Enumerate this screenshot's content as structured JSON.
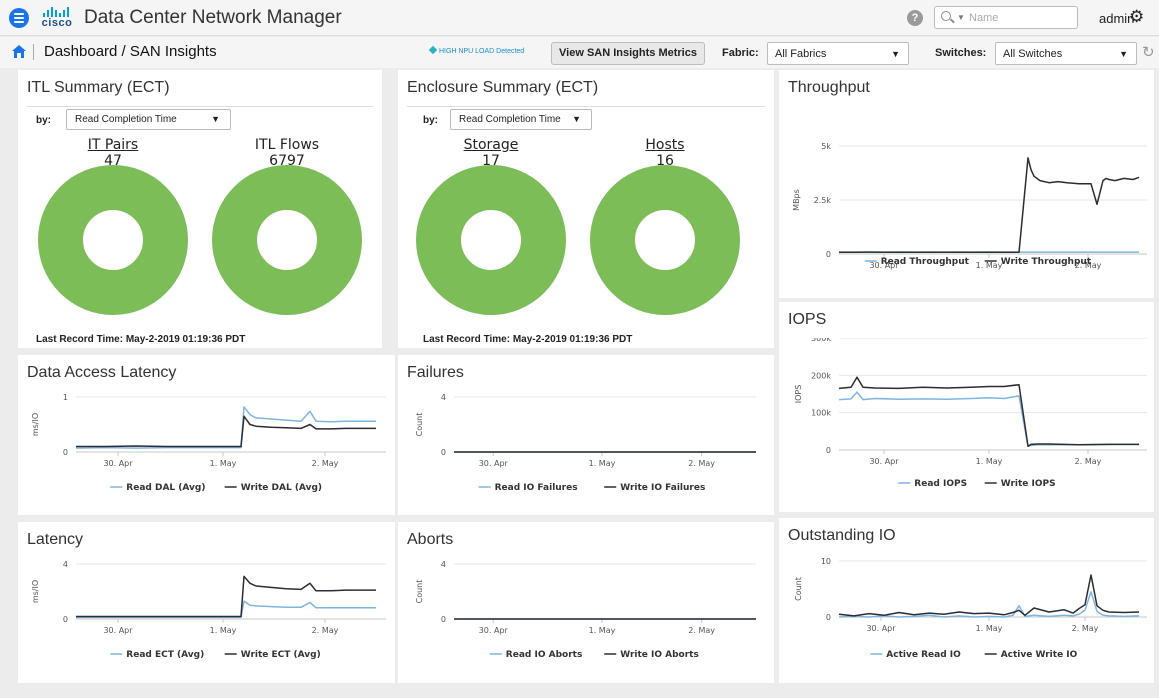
{
  "topbar": {
    "app_title": "Data Center Network Manager",
    "brand": "cisco",
    "search_placeholder": "Name",
    "user": "admin"
  },
  "subbar": {
    "breadcrumb": "Dashboard / SAN Insights",
    "alert": "HIGH NPU LOAD Detected",
    "view_metrics_button": "View SAN Insights Metrics",
    "fabric_label": "Fabric:",
    "fabric_value": "All Fabrics",
    "switches_label": "Switches:",
    "switches_value": "All Switches"
  },
  "itl_summary": {
    "title": "ITL Summary (ECT)",
    "by_label": "by:",
    "by_value": "Read Completion Time",
    "metric1_label": "IT Pairs",
    "metric1_value": "47",
    "metric2_label": "ITL Flows",
    "metric2_value": "6797",
    "last_record": "Last Record Time: May-2-2019 01:19:36 PDT",
    "donut_color": "#7cbd58"
  },
  "enclosure_summary": {
    "title": "Enclosure Summary (ECT)",
    "by_label": "by:",
    "by_value": "Read Completion Time",
    "metric1_label": "Storage",
    "metric1_value": "17",
    "metric2_label": "Hosts",
    "metric2_value": "16",
    "last_record": "Last Record Time: May-2-2019 01:19:36 PDT",
    "donut_color": "#7cbd58"
  },
  "panels": {
    "throughput": {
      "title": "Throughput"
    },
    "iops": {
      "title": "IOPS"
    },
    "dal": {
      "title": "Data Access Latency"
    },
    "failures": {
      "title": "Failures"
    },
    "outstanding": {
      "title": "Outstanding IO"
    },
    "latency": {
      "title": "Latency"
    },
    "aborts": {
      "title": "Aborts"
    }
  },
  "series_colors": {
    "read": "#7fb5e1",
    "write": "#2a2d33"
  },
  "chart_data": [
    {
      "type": "line",
      "id": "throughput",
      "title": "Throughput",
      "ylabel": "MBps",
      "ylim": [
        0,
        5000
      ],
      "yticks": [
        "0",
        "2.5k",
        "5k"
      ],
      "xticks": [
        "30. Apr",
        "1. May",
        "2. May"
      ],
      "x": [
        0,
        0.05,
        0.1,
        0.15,
        0.2,
        0.25,
        0.3,
        0.35,
        0.4,
        0.45,
        0.5,
        0.55,
        0.6,
        0.63,
        0.64,
        0.65,
        0.67,
        0.7,
        0.73,
        0.76,
        0.8,
        0.84,
        0.86,
        0.88,
        0.89,
        0.9,
        0.92,
        0.95,
        0.98,
        1.0
      ],
      "series": [
        {
          "name": "Read Throughput",
          "color": "#7fb5e1",
          "values": [
            90,
            90,
            92,
            90,
            91,
            90,
            92,
            90,
            91,
            90,
            92,
            90,
            90,
            90,
            90,
            90,
            90,
            90,
            90,
            90,
            90,
            90,
            90,
            90,
            90,
            90,
            90,
            90,
            90,
            90
          ]
        },
        {
          "name": "Write Throughput",
          "color": "#2a2d33",
          "values": [
            80,
            85,
            90,
            85,
            80,
            85,
            80,
            82,
            85,
            80,
            85,
            82,
            80,
            4450,
            3900,
            3600,
            3400,
            3300,
            3350,
            3300,
            3250,
            3250,
            2300,
            3400,
            3500,
            3450,
            3400,
            3500,
            3450,
            3550
          ]
        }
      ],
      "legend": "bottom"
    },
    {
      "type": "line",
      "id": "iops",
      "title": "IOPS",
      "ylabel": "IOPS",
      "ylim": [
        0,
        300000
      ],
      "yticks": [
        "0",
        "100k",
        "200k",
        "300k"
      ],
      "xticks": [
        "30. Apr",
        "1. May",
        "2. May"
      ],
      "x": [
        0,
        0.04,
        0.06,
        0.08,
        0.12,
        0.2,
        0.28,
        0.36,
        0.44,
        0.5,
        0.55,
        0.6,
        0.63,
        0.64,
        0.66,
        0.7,
        0.8,
        0.9,
        1.0
      ],
      "series": [
        {
          "name": "Read IOPS",
          "color": "#7fb5e1",
          "values": [
            135000,
            137000,
            155000,
            135000,
            138000,
            136000,
            137000,
            136000,
            138000,
            140000,
            138000,
            145000,
            10000,
            12000,
            14000,
            14000,
            14000,
            15000,
            15000
          ]
        },
        {
          "name": "Write IOPS",
          "color": "#2a2d33",
          "values": [
            165000,
            168000,
            195000,
            168000,
            166000,
            165000,
            168000,
            166000,
            168000,
            170000,
            170000,
            175000,
            10000,
            15000,
            16000,
            16000,
            14000,
            15000,
            15000
          ]
        }
      ],
      "legend": "bottom"
    },
    {
      "type": "line",
      "id": "dal",
      "title": "Data Access Latency",
      "ylabel": "ms/IO",
      "ylim": [
        0,
        1
      ],
      "yticks": [
        "0",
        "1"
      ],
      "xticks": [
        "30. Apr",
        "1. May",
        "2. May"
      ],
      "x": [
        0,
        0.1,
        0.2,
        0.3,
        0.4,
        0.5,
        0.55,
        0.56,
        0.58,
        0.6,
        0.65,
        0.7,
        0.75,
        0.78,
        0.8,
        0.85,
        0.9,
        1.0
      ],
      "series": [
        {
          "name": "Read DAL (Avg)",
          "color": "#7fb5e1",
          "values": [
            0.07,
            0.08,
            0.07,
            0.08,
            0.08,
            0.08,
            0.08,
            0.82,
            0.68,
            0.62,
            0.6,
            0.58,
            0.56,
            0.74,
            0.56,
            0.55,
            0.56,
            0.56
          ]
        },
        {
          "name": "Write DAL (Avg)",
          "color": "#2a2d33",
          "values": [
            0.1,
            0.1,
            0.11,
            0.1,
            0.1,
            0.1,
            0.1,
            0.65,
            0.5,
            0.47,
            0.45,
            0.44,
            0.43,
            0.5,
            0.42,
            0.42,
            0.43,
            0.43
          ]
        }
      ],
      "legend": "bottom"
    },
    {
      "type": "line",
      "id": "failures",
      "title": "Failures",
      "ylabel": "Count",
      "ylim": [
        0,
        4
      ],
      "yticks": [
        "0",
        "4"
      ],
      "xticks": [
        "30. Apr",
        "1. May",
        "2. May"
      ],
      "x": [
        0,
        1
      ],
      "series": [
        {
          "name": "Read IO Failures",
          "color": "#7fb5e1",
          "values": [
            0,
            0
          ]
        },
        {
          "name": "Write IO Failures",
          "color": "#2a2d33",
          "values": [
            0,
            0
          ]
        }
      ],
      "legend": "bottom"
    },
    {
      "type": "line",
      "id": "outstanding",
      "title": "Outstanding IO",
      "ylabel": "Count",
      "ylim": [
        0,
        10
      ],
      "yticks": [
        "0",
        "10"
      ],
      "xticks": [
        "30. Apr",
        "1. May",
        "2. May"
      ],
      "x": [
        0,
        0.05,
        0.1,
        0.15,
        0.2,
        0.25,
        0.3,
        0.35,
        0.4,
        0.45,
        0.5,
        0.55,
        0.58,
        0.6,
        0.62,
        0.65,
        0.7,
        0.75,
        0.78,
        0.8,
        0.82,
        0.84,
        0.86,
        0.88,
        0.9,
        0.95,
        1.0
      ],
      "series": [
        {
          "name": "Active Read IO",
          "color": "#7fb5e1",
          "values": [
            0,
            0.1,
            0,
            0.2,
            0,
            0.1,
            0.3,
            0,
            0.2,
            0,
            0.1,
            0,
            0.3,
            2,
            0.1,
            0.3,
            0.1,
            0.3,
            0.2,
            0.5,
            1.2,
            4.5,
            1,
            0.3,
            0.2,
            0.1,
            0.2
          ]
        },
        {
          "name": "Active Write IO",
          "color": "#2a2d33",
          "values": [
            0.5,
            0.2,
            0.6,
            0.3,
            0.8,
            0.4,
            0.7,
            0.5,
            0.9,
            0.6,
            0.7,
            0.4,
            0.8,
            1.2,
            0.3,
            1.6,
            0.9,
            1.3,
            0.7,
            1.5,
            2.2,
            7.5,
            2,
            1.2,
            0.9,
            0.8,
            0.9
          ]
        }
      ],
      "legend": "bottom"
    },
    {
      "type": "line",
      "id": "latency",
      "title": "Latency",
      "ylabel": "ms/IO",
      "ylim": [
        0,
        4
      ],
      "yticks": [
        "0",
        "4"
      ],
      "xticks": [
        "30. Apr",
        "1. May",
        "2. May"
      ],
      "x": [
        0,
        0.1,
        0.2,
        0.3,
        0.4,
        0.5,
        0.55,
        0.56,
        0.58,
        0.6,
        0.65,
        0.7,
        0.75,
        0.78,
        0.8,
        0.85,
        0.9,
        1.0
      ],
      "series": [
        {
          "name": "Read ECT (Avg)",
          "color": "#7fb5e1",
          "values": [
            0.12,
            0.12,
            0.12,
            0.12,
            0.12,
            0.12,
            0.12,
            1.3,
            1,
            0.95,
            0.9,
            0.85,
            0.85,
            1.2,
            0.82,
            0.82,
            0.82,
            0.82
          ]
        },
        {
          "name": "Write ECT (Avg)",
          "color": "#2a2d33",
          "values": [
            0.18,
            0.18,
            0.18,
            0.18,
            0.18,
            0.18,
            0.18,
            3.1,
            2.6,
            2.4,
            2.3,
            2.2,
            2.15,
            2.6,
            2.05,
            2.05,
            2.1,
            2.1
          ]
        }
      ],
      "legend": "bottom"
    },
    {
      "type": "line",
      "id": "aborts",
      "title": "Aborts",
      "ylabel": "Count",
      "ylim": [
        0,
        4
      ],
      "yticks": [
        "0",
        "4"
      ],
      "xticks": [
        "30. Apr",
        "1. May",
        "2. May"
      ],
      "x": [
        0,
        1
      ],
      "series": [
        {
          "name": "Read IO Aborts",
          "color": "#7fb5e1",
          "values": [
            0,
            0
          ]
        },
        {
          "name": "Write IO Aborts",
          "color": "#2a2d33",
          "values": [
            0,
            0
          ]
        }
      ],
      "legend": "bottom"
    }
  ]
}
